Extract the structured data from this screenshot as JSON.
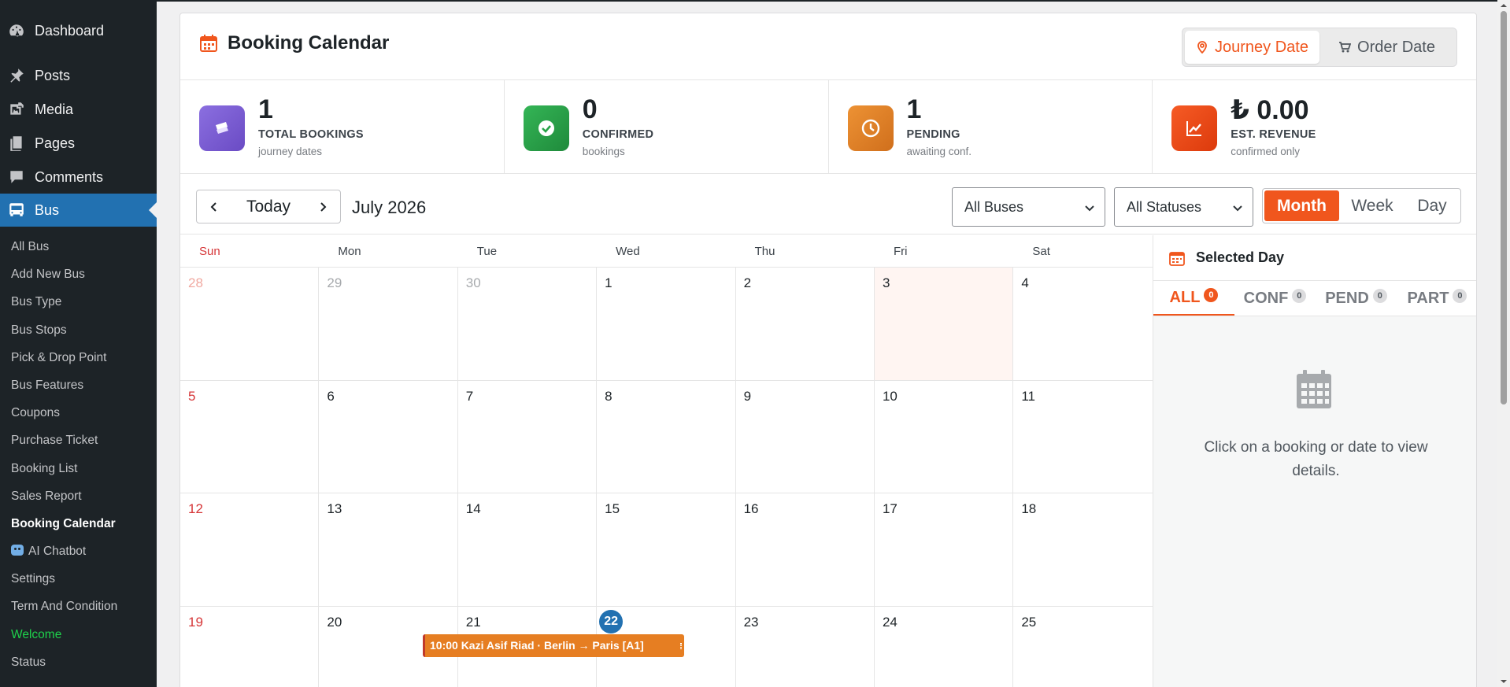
{
  "sidebar": {
    "top_items": [
      {
        "label": "Dashboard",
        "icon": "dashboard-icon"
      },
      {
        "label": "Posts",
        "icon": "pin-icon"
      },
      {
        "label": "Media",
        "icon": "media-icon"
      },
      {
        "label": "Pages",
        "icon": "pages-icon"
      },
      {
        "label": "Comments",
        "icon": "comments-icon"
      },
      {
        "label": "Bus",
        "icon": "bus-icon"
      }
    ],
    "sub_items": [
      "All Bus",
      "Add New Bus",
      "Bus Type",
      "Bus Stops",
      "Pick & Drop Point",
      "Bus Features",
      "Coupons",
      "Purchase Ticket",
      "Booking List",
      "Sales Report",
      "Booking Calendar",
      "AI Chatbot",
      "Settings",
      "Term And Condition",
      "Welcome",
      "Status"
    ]
  },
  "header": {
    "title": "Booking Calendar",
    "toggle": {
      "journey": "Journey Date",
      "order": "Order Date"
    }
  },
  "stats": [
    {
      "value": "1",
      "label": "TOTAL BOOKINGS",
      "sub": "journey dates",
      "color": "#7c5cd6"
    },
    {
      "value": "0",
      "label": "CONFIRMED",
      "sub": "bookings",
      "color": "#27a347"
    },
    {
      "value": "1",
      "label": "PENDING",
      "sub": "awaiting conf.",
      "color": "#e0822b"
    },
    {
      "value": "₺ 0.00",
      "label": "EST. REVENUE",
      "sub": "confirmed only",
      "color": "#ee4b18"
    }
  ],
  "toolbar": {
    "today": "Today",
    "month_label": "July 2026",
    "bus_filter": "All Buses",
    "status_filter": "All Statuses",
    "views": [
      "Month",
      "Week",
      "Day"
    ]
  },
  "calendar": {
    "weekdays": [
      "Sun",
      "Mon",
      "Tue",
      "Wed",
      "Thu",
      "Fri",
      "Sat"
    ],
    "weeks": [
      [
        "28",
        "29",
        "30",
        "1",
        "2",
        "3",
        "4"
      ],
      [
        "5",
        "6",
        "7",
        "8",
        "9",
        "10",
        "11"
      ],
      [
        "12",
        "13",
        "14",
        "15",
        "16",
        "17",
        "18"
      ],
      [
        "19",
        "20",
        "21",
        "22",
        "23",
        "24",
        "25"
      ]
    ],
    "event": "10:00 Kazi Asif Riad · Berlin → Paris [A1]"
  },
  "panel": {
    "title": "Selected Day",
    "tabs": [
      {
        "label": "ALL",
        "count": "0"
      },
      {
        "label": "CONF",
        "count": "0"
      },
      {
        "label": "PEND",
        "count": "0"
      },
      {
        "label": "PART",
        "count": "0"
      }
    ],
    "empty_text": "Click on a booking or date to view details."
  },
  "colors": {
    "accent": "#f0561d",
    "wp_blue": "#2271b1",
    "sidebar_bg": "#1d2327"
  }
}
